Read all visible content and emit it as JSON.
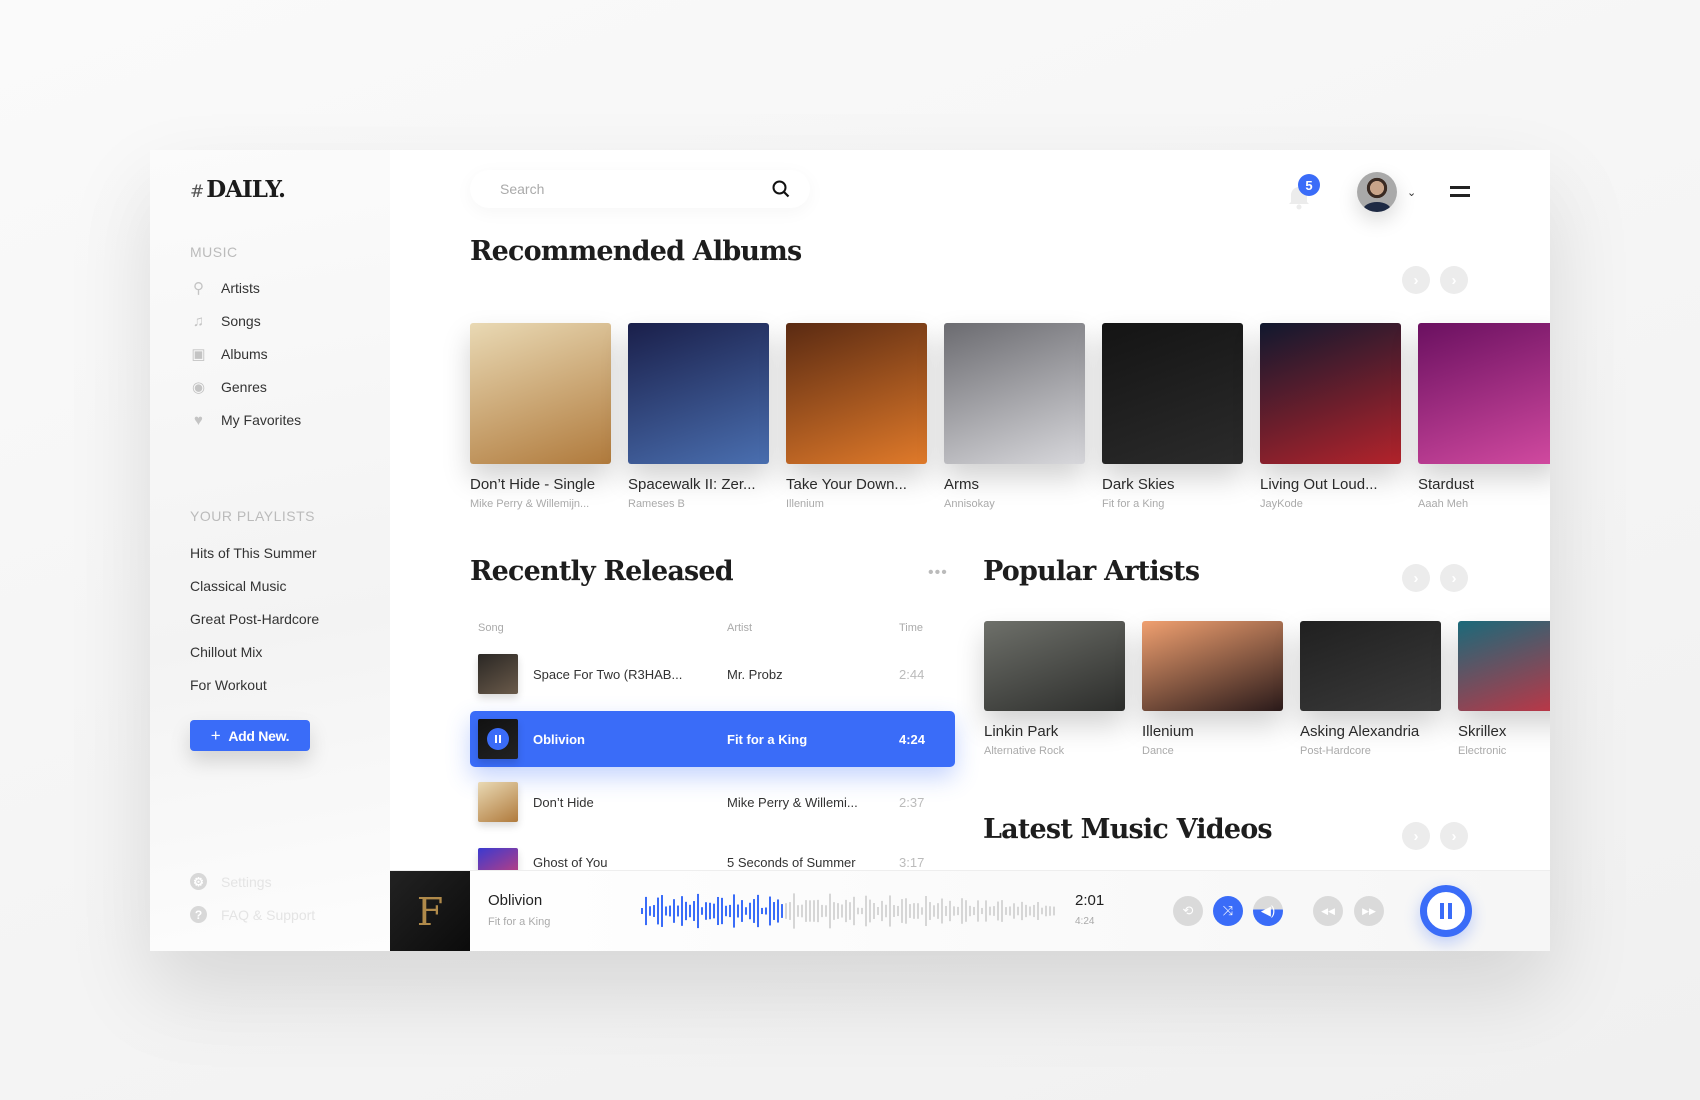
{
  "app": {
    "logo_hash": "#",
    "logo_text": "DAILY."
  },
  "sidebar": {
    "music_label": "MUSIC",
    "items": [
      {
        "label": "Artists",
        "icon": "microphone-icon",
        "glyph": "🎤"
      },
      {
        "label": "Songs",
        "icon": "music-note-icon",
        "glyph": "♫"
      },
      {
        "label": "Albums",
        "icon": "album-icon",
        "glyph": "▣"
      },
      {
        "label": "Genres",
        "icon": "disc-icon",
        "glyph": "◉"
      },
      {
        "label": "My Favorites",
        "icon": "heart-icon",
        "glyph": "♥"
      }
    ],
    "playlists_label": "YOUR PLAYLISTS",
    "playlists": [
      "Hits of This Summer",
      "Classical Music",
      "Great Post-Hardcore",
      "Chillout Mix",
      "For Workout"
    ],
    "add_button": "Add New.",
    "add_icon": "+",
    "settings": "Settings",
    "faq": "FAQ & Support"
  },
  "header": {
    "search_placeholder": "Search",
    "notification_count": "5"
  },
  "recommended": {
    "title": "Recommended Albums",
    "albums": [
      {
        "title": "Don’t Hide - Single",
        "artist": "Mike Perry & Willemijn...",
        "colors": [
          "#e9d9b4",
          "#b07a3c"
        ]
      },
      {
        "title": "Spacewalk II: Zer...",
        "artist": "Rameses B",
        "colors": [
          "#1a1f4a",
          "#4a6fb0"
        ]
      },
      {
        "title": "Take Your Down...",
        "artist": "Illenium",
        "colors": [
          "#5a2a12",
          "#e07a2a"
        ]
      },
      {
        "title": "Arms",
        "artist": "Annisokay",
        "colors": [
          "#6b6b70",
          "#d8d8dc"
        ]
      },
      {
        "title": "Dark Skies",
        "artist": "Fit for a King",
        "colors": [
          "#141414",
          "#2b2b2b"
        ]
      },
      {
        "title": "Living Out Loud...",
        "artist": "JayKode",
        "colors": [
          "#10182e",
          "#b3232b"
        ]
      },
      {
        "title": "Stardust",
        "artist": "Aaah Meh",
        "colors": [
          "#6a1060",
          "#d24aa0"
        ]
      }
    ]
  },
  "recent": {
    "title": "Recently Released",
    "more_icon": "•••",
    "columns": {
      "song": "Song",
      "artist": "Artist",
      "time": "Time"
    },
    "rows": [
      {
        "song": "Space For Two (R3HAB...",
        "artist": "Mr. Probz",
        "time": "2:44",
        "colors": [
          "#2a2724",
          "#6a5a4a"
        ],
        "active": false
      },
      {
        "song": "Oblivion",
        "artist": "Fit for a King",
        "time": "4:24",
        "colors": [
          "#111",
          "#222"
        ],
        "active": true
      },
      {
        "song": "Don’t Hide",
        "artist": "Mike Perry & Willemi...",
        "time": "2:37",
        "colors": [
          "#e9d9b4",
          "#b07a3c"
        ],
        "active": false
      },
      {
        "song": "Ghost of You",
        "artist": "5 Seconds of Summer",
        "time": "3:17",
        "colors": [
          "#3a3ad0",
          "#e0406a"
        ],
        "active": false
      }
    ]
  },
  "artists": {
    "title": "Popular Artists",
    "items": [
      {
        "name": "Linkin Park",
        "genre": "Alternative Rock",
        "colors": [
          "#6e706a",
          "#2c2d2b"
        ]
      },
      {
        "name": "Illenium",
        "genre": "Dance",
        "colors": [
          "#f0a070",
          "#2a1a1a"
        ]
      },
      {
        "name": "Asking Alexandria",
        "genre": "Post-Hardcore",
        "colors": [
          "#202020",
          "#3a3a3a"
        ]
      },
      {
        "name": "Skrillex",
        "genre": "Electronic",
        "colors": [
          "#1a6a7a",
          "#d03040"
        ]
      }
    ]
  },
  "videos": {
    "title": "Latest Music Videos"
  },
  "player": {
    "title": "Oblivion",
    "artist": "Fit for a King",
    "elapsed": "2:01",
    "duration": "4:24",
    "progress": 0.34,
    "controls": [
      {
        "name": "repeat",
        "glyph": "⟲",
        "active": false
      },
      {
        "name": "shuffle",
        "glyph": "⤨",
        "active": true
      },
      {
        "name": "volume",
        "glyph": "🔈",
        "active": true
      },
      {
        "name": "rewind",
        "glyph": "◀◀",
        "active": false
      },
      {
        "name": "fast-forward",
        "glyph": "▶▶",
        "active": false
      }
    ]
  },
  "colors": {
    "accent": "#3a6cf8"
  }
}
